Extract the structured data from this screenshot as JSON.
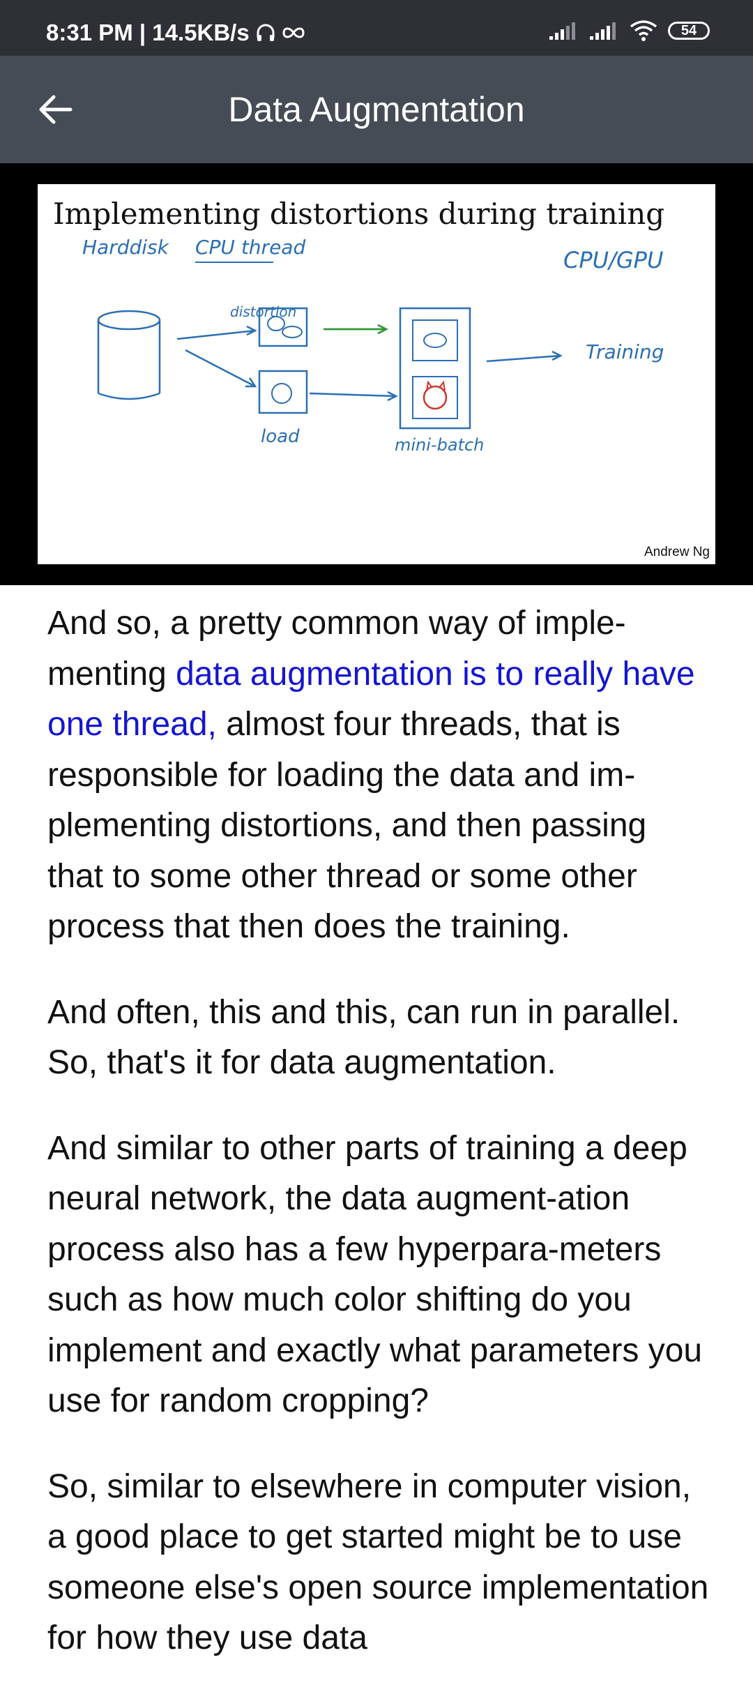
{
  "status_bar": {
    "time_speed": "8:31 PM | 14.5KB/s",
    "battery": "54"
  },
  "app_bar": {
    "title": "Data Augmentation"
  },
  "slide": {
    "title": "Implementing distortions during training",
    "labels": {
      "harddisk": "Harddisk",
      "cpu_thread": "CPU thread",
      "distortion": "distortion",
      "cpu_gpu": "CPU/GPU",
      "training": "Training",
      "load": "load",
      "mini_batch": "mini-batch"
    },
    "credit": "Andrew Ng"
  },
  "transcript": {
    "p1_before": "And so, a pretty common way of imple-menting ",
    "p1_highlight": "data augmentation is to really have one thread,",
    "p1_after": " almost four threads, that is responsible for loading the data and im-plementing distortions, and then passing that to some other thread or some other process that then does the training.",
    "p2": "And often, this and this, can run in parallel. So, that's it for data augmentation.",
    "p3": "And similar to other parts of training a deep neural network, the data augment-ation process also has a few hyperpara-meters such as how much color shifting do you implement and exactly what parameters you use for random cropping?",
    "p4": "So, similar to elsewhere in computer vision, a good place to get started might be to use someone else's open source implementation for how they use data"
  }
}
